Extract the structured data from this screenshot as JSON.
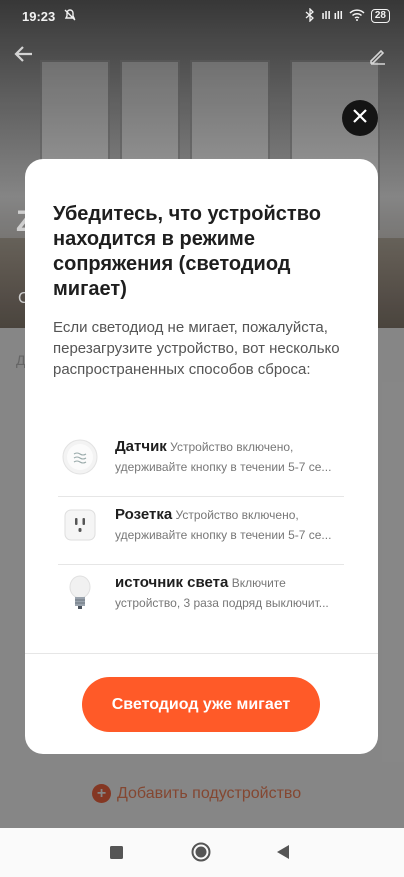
{
  "status_bar": {
    "time": "19:23",
    "signal_text": "ıll ıll",
    "battery": "28"
  },
  "background": {
    "title_partial": "Z",
    "subtitle_partial": "C",
    "row_partial": "Д",
    "add_subdevice": "Добавить подустройство"
  },
  "modal": {
    "title": "Убедитесь, что устройство находится в режиме сопряжения (светодиод мигает)",
    "description": "Если светодиод не мигает, пожалуйста, перезагрузите устройство, вот несколько распространенных способов сброса:",
    "devices": [
      {
        "icon": "sensor-icon",
        "name": "Датчик",
        "line1": "Устройство включено,",
        "line2": "удерживайте кнопку в течении 5-7 се..."
      },
      {
        "icon": "socket-icon",
        "name": "Розетка",
        "line1": "Устройство включено,",
        "line2": "удерживайте кнопку в течении 5-7 се..."
      },
      {
        "icon": "bulb-icon",
        "name": "источник света",
        "line1": "Включите",
        "line2": "устройство, 3 раза подряд выключит..."
      }
    ],
    "primary_button": "Светодиод уже мигает"
  },
  "colors": {
    "accent": "#ff5a28",
    "modal_bg": "#ffffff",
    "close_bg": "#141414"
  }
}
